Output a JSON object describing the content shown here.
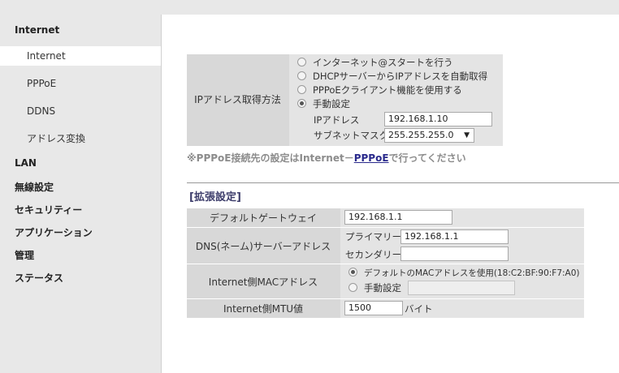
{
  "sidebar": {
    "internet_section": "Internet",
    "items": [
      {
        "label": "Internet"
      },
      {
        "label": "PPPoE"
      },
      {
        "label": "DDNS"
      },
      {
        "label": "アドレス変換"
      }
    ],
    "lan": "LAN",
    "wireless": "無線設定",
    "security": "セキュリティー",
    "application": "アプリケーション",
    "admin": "管理",
    "status": "ステータス"
  },
  "ip_method": {
    "label": "IPアドレス取得方法",
    "options": [
      {
        "label": "インターネット@スタートを行う",
        "selected": false
      },
      {
        "label": "DHCPサーバーからIPアドレスを自動取得",
        "selected": false
      },
      {
        "label": "PPPoEクライアント機能を使用する",
        "selected": false
      },
      {
        "label": "手動設定",
        "selected": true
      }
    ],
    "ip_label": "IPアドレス",
    "ip_value": "192.168.1.10",
    "subnet_label": "サブネットマスク",
    "subnet_value": "255.255.255.0"
  },
  "note": {
    "prefix": "※PPPoE接続先の設定はInternet－",
    "link": "PPPoE",
    "suffix": "で行ってください"
  },
  "extended": {
    "title": "[拡張設定]",
    "gateway_label": "デフォルトゲートウェイ",
    "gateway_value": "192.168.1.1",
    "dns_label": "DNS(ネーム)サーバーアドレス",
    "dns_primary_label": "プライマリー:",
    "dns_primary_value": "192.168.1.1",
    "dns_secondary_label": "セカンダリー:",
    "dns_secondary_value": "",
    "mac_label": "Internet側MACアドレス",
    "mac_default_label": "デフォルトのMACアドレスを使用(18:C2:BF:90:F7:A0)",
    "mac_manual_label": "手動設定",
    "mac_manual_value": "",
    "mtu_label": "Internet側MTU値",
    "mtu_value": "1500",
    "mtu_unit": "バイト"
  }
}
